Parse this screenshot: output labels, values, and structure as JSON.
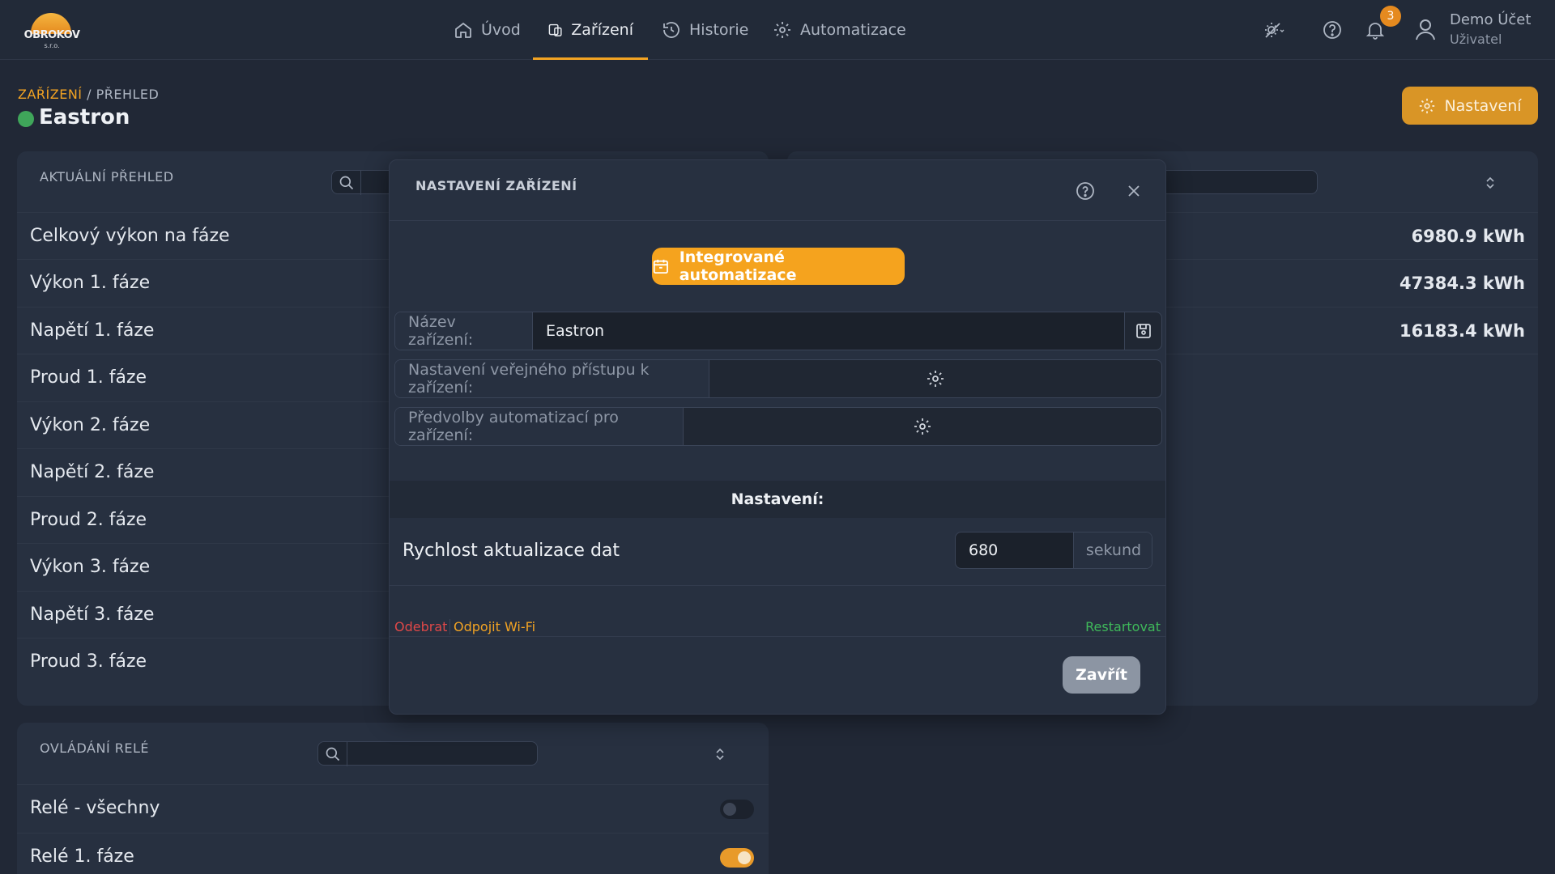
{
  "header": {
    "logo_text": "OBROKOV",
    "logo_sub": "s.r.o.",
    "nav": [
      {
        "label": "Úvod",
        "icon": "home-icon"
      },
      {
        "label": "Zařízení",
        "icon": "devices-icon",
        "active": true
      },
      {
        "label": "Historie",
        "icon": "history-icon"
      },
      {
        "label": "Automatizace",
        "icon": "gear-icon"
      }
    ],
    "notification_count": "3",
    "user_name": "Demo Účet",
    "user_role": "Uživatel"
  },
  "breadcrumb": {
    "section": "ZAŘÍZENÍ",
    "separator": " / ",
    "page": "PŘEHLED"
  },
  "page_title": "Eastron",
  "status_color": "#3fa65a",
  "settings_button": "Nastavení",
  "overview_panel": {
    "title": "AKTUÁLNÍ PŘEHLED",
    "rows": [
      {
        "label": "Celkový výkon na fáze",
        "value": "6980.9 kWh"
      },
      {
        "label": "Výkon 1. fáze",
        "value": "47384.3 kWh"
      },
      {
        "label": "Napětí 1. fáze",
        "value": "16183.4 kWh"
      },
      {
        "label": "Proud 1. fáze",
        "value": ""
      },
      {
        "label": "Výkon 2. fáze",
        "value": ""
      },
      {
        "label": "Napětí 2. fáze",
        "value": ""
      },
      {
        "label": "Proud 2. fáze",
        "value": ""
      },
      {
        "label": "Výkon 3. fáze",
        "value": ""
      },
      {
        "label": "Napětí 3. fáze",
        "value": ""
      },
      {
        "label": "Proud 3. fáze",
        "value": ""
      }
    ]
  },
  "relay_panel": {
    "title": "OVLÁDÁNÍ RELÉ",
    "rows": [
      {
        "label": "Relé - všechny",
        "on": false
      },
      {
        "label": "Relé 1. fáze",
        "on": true
      }
    ]
  },
  "modal": {
    "title": "NASTAVENÍ ZAŘÍZENÍ",
    "auto_button": "Integrované automatizace",
    "name_label": "Název zařízení:",
    "name_value": "Eastron",
    "public_label": "Nastavení veřejného přístupu k zařízení:",
    "presets_label": "Předvolby automatizací pro zařízení:",
    "section_title": "Nastavení:",
    "speed_label": "Rychlost aktualizace dat",
    "speed_value": "680",
    "speed_unit": "sekund",
    "remove_link": "Odebrat",
    "wifi_link": "Odpojit Wi-Fi",
    "restart_link": "Restartovat",
    "close_button": "Zavřít"
  },
  "colors": {
    "accent": "#f2a323",
    "danger": "#e04848",
    "success": "#3fb95a"
  }
}
